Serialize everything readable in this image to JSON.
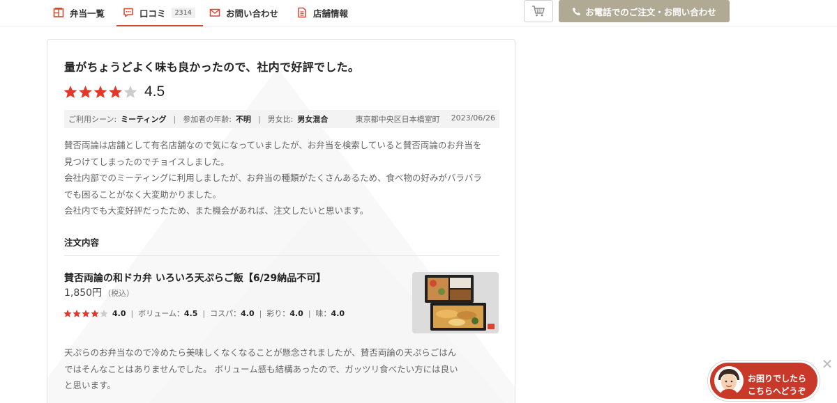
{
  "nav": {
    "items": [
      {
        "label": "弁当一覧",
        "icon": "bento-icon"
      },
      {
        "label": "口コミ",
        "icon": "chat-icon",
        "badge": "2314"
      },
      {
        "label": "お問い合わせ",
        "icon": "mail-icon"
      },
      {
        "label": "店舗情報",
        "icon": "document-icon"
      }
    ],
    "cart_icon": "cart-icon",
    "phone_label": "お電話でのご注文・お問い合わせ"
  },
  "review": {
    "title": "量がちょうどよく味も良かったので、社内で好評でした。",
    "rating": 4.5,
    "rating_text": "4.5",
    "meta": {
      "scene_label": "ご利用シーン:",
      "scene_value": "ミーティング",
      "age_label": "参加者の年齢:",
      "age_value": "不明",
      "gender_label": "男女比:",
      "gender_value": "男女混合",
      "location": "東京都中央区日本橋室町",
      "date": "2023/06/26"
    },
    "body": [
      "賛否両論は店舗として有名店舗なので気になっていましたが、お弁当を検索していると賛否両論のお弁当を",
      "見つけてしまったのでチョイスしました。",
      "会社内部でのミーティングに利用しましたが、お弁当の種類がたくさんあるため、食べ物の好みがバラバラ",
      "でも困ることがなく大変助かりました。",
      "会社内でも大変好評だったため、また機会があれば、注文したいと思います。"
    ],
    "order_heading": "注文内容",
    "item": {
      "name": "賛否両論の和ドカ弁 いろいろ天ぷらご飯【6/29納品不可】",
      "price": "1,850円",
      "tax": "（税込）",
      "rating": 4.0,
      "rating_text": "4.0",
      "volume_label": "ボリューム：",
      "volume": "4.5",
      "cospa_label": "コスパ：",
      "cospa": "4.0",
      "color_label": "彩り：",
      "color": "4.0",
      "taste_label": "味：",
      "taste": "4.0"
    },
    "comment": [
      "天ぷらのお弁当なので冷めたら美味しくなくなることが懸念されましたが、賛否両論の天ぷらごはん",
      "ではそんなことはありませんでした。 ボリューム感も結構あったので、ガッツリ食べたい方には良い",
      "と思います。"
    ]
  },
  "help": {
    "line1": "お困りでしたら",
    "line2": "こちらへどうぞ",
    "close": "✕"
  },
  "colors": {
    "accent": "#d9452d",
    "star": "#e3372a",
    "phone_button": "#b0a994",
    "help_bubble": "#c9392a"
  }
}
